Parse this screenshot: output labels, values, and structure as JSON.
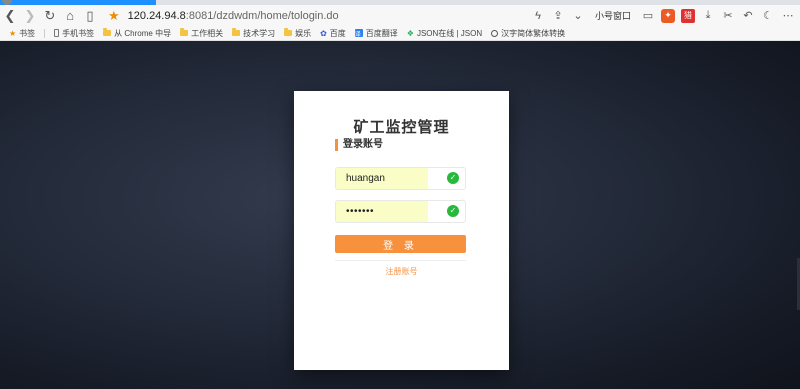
{
  "browser": {
    "url_host": "120.24.94.8",
    "url_port_path": ":8081/dzdwdm/home/tologin.do",
    "small_window_label": "小号窗口",
    "ext_label": "猎"
  },
  "bookmarks": {
    "items": [
      {
        "label": "书签",
        "icon": "star-icon"
      },
      {
        "label": "手机书签",
        "icon": "phone-icon"
      },
      {
        "label": "从 Chrome 中导",
        "icon": "folder-icon"
      },
      {
        "label": "工作相关",
        "icon": "folder-icon"
      },
      {
        "label": "技术学习",
        "icon": "folder-icon"
      },
      {
        "label": "娱乐",
        "icon": "folder-icon"
      },
      {
        "label": "百度",
        "icon": "paw-icon"
      },
      {
        "label": "百度翻译",
        "icon": "translate-icon"
      },
      {
        "label": "JSON在线 | JSON",
        "icon": "json-icon"
      },
      {
        "label": "汉字简体繁体转换",
        "icon": "globe-icon"
      }
    ]
  },
  "login": {
    "title": "矿工监控管理",
    "subtitle": "登录账号",
    "username_value": "huangan",
    "password_value": "1234567",
    "login_button": "登 录",
    "register_link": "注册账号"
  },
  "colors": {
    "accent": "#f7913d",
    "success": "#27b93b",
    "autofill": "#fafdc6",
    "background_dark": "#1b2130"
  }
}
